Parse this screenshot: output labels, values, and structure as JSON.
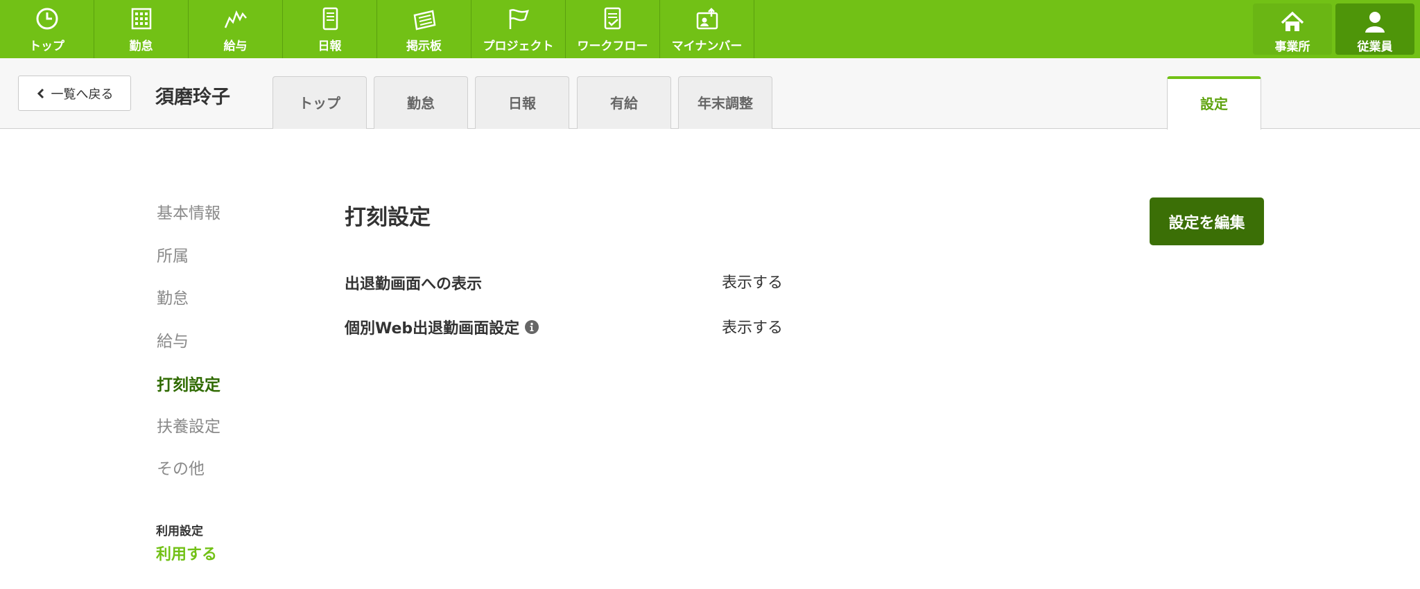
{
  "topnav": {
    "items": [
      {
        "label": "トップ",
        "icon": "clock-icon"
      },
      {
        "label": "勤怠",
        "icon": "calendar-icon"
      },
      {
        "label": "給与",
        "icon": "chart-icon"
      },
      {
        "label": "日報",
        "icon": "notebook-icon"
      },
      {
        "label": "掲示板",
        "icon": "board-icon"
      },
      {
        "label": "プロジェクト",
        "icon": "flag-icon"
      },
      {
        "label": "ワークフロー",
        "icon": "checklist-icon"
      },
      {
        "label": "マイナンバー",
        "icon": "id-card-icon"
      }
    ],
    "right": [
      {
        "label": "事業所",
        "icon": "home-icon"
      },
      {
        "label": "従業員",
        "icon": "user-icon",
        "active": true
      }
    ],
    "color": "#72c116"
  },
  "subhead": {
    "back_label": "一覧へ戻る",
    "employee_name": "須磨玲子",
    "tabs": [
      "トップ",
      "勤怠",
      "日報",
      "有給",
      "年末調整"
    ],
    "settings_tab": "設定"
  },
  "sidebar": {
    "items": [
      "基本情報",
      "所属",
      "勤怠",
      "給与",
      "打刻設定",
      "扶養設定",
      "その他"
    ],
    "active_index": 4,
    "usage_label": "利用設定",
    "usage_value": "利用する"
  },
  "main": {
    "title": "打刻設定",
    "edit_button": "設定を編集",
    "rows": [
      {
        "label": "出退勤画面への表示",
        "value": "表示する"
      },
      {
        "label": "個別Web出退勤画面設定",
        "value": "表示する",
        "has_info": true
      }
    ]
  }
}
